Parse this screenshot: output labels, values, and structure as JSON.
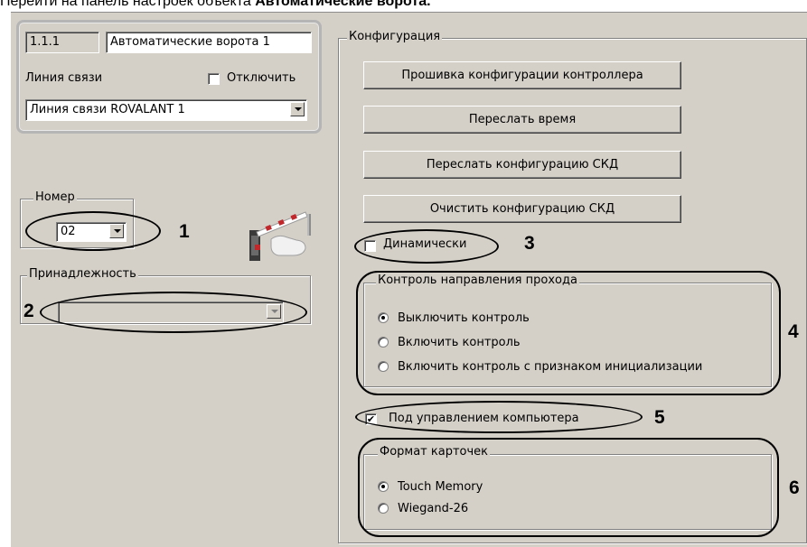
{
  "caption": {
    "prefix": "Перейти на панель настроек объекта ",
    "object_name": "Автоматические ворота."
  },
  "object_header": {
    "id_value": "1.1.1",
    "name_value": "Автоматические ворота 1",
    "comm_line_label": "Линия связи",
    "disable_label": "Отключить",
    "disable_checked": false,
    "comm_line_value": "Линия связи ROVALANT 1"
  },
  "number_group": {
    "legend": "Номер",
    "value": "02"
  },
  "ownership_group": {
    "legend": "Принадлежность",
    "value": ""
  },
  "object_icon": "barrier-gate-icon",
  "config_group": {
    "legend": "Конфигурация",
    "buttons": [
      "Прошивка конфигурации контроллера",
      "Переслать время",
      "Переслать конфигурацию СКД",
      "Очистить конфигурацию СКД"
    ]
  },
  "dynamic": {
    "label": "Динамически",
    "checked": false
  },
  "direction_control": {
    "legend": "Контроль направления прохода",
    "options": [
      "Выключить контроль",
      "Включить контроль",
      "Включить контроль с признаком инициализации"
    ],
    "selected": 0
  },
  "computer_control": {
    "label": "Под управлением компьютера",
    "checked": true,
    "check_glyph": "✔"
  },
  "card_format": {
    "legend": "Формат карточек",
    "options": [
      "Touch Memory",
      "Wiegand-26"
    ],
    "selected": 0
  },
  "callouts": [
    "1",
    "2",
    "3",
    "4",
    "5",
    "6"
  ]
}
